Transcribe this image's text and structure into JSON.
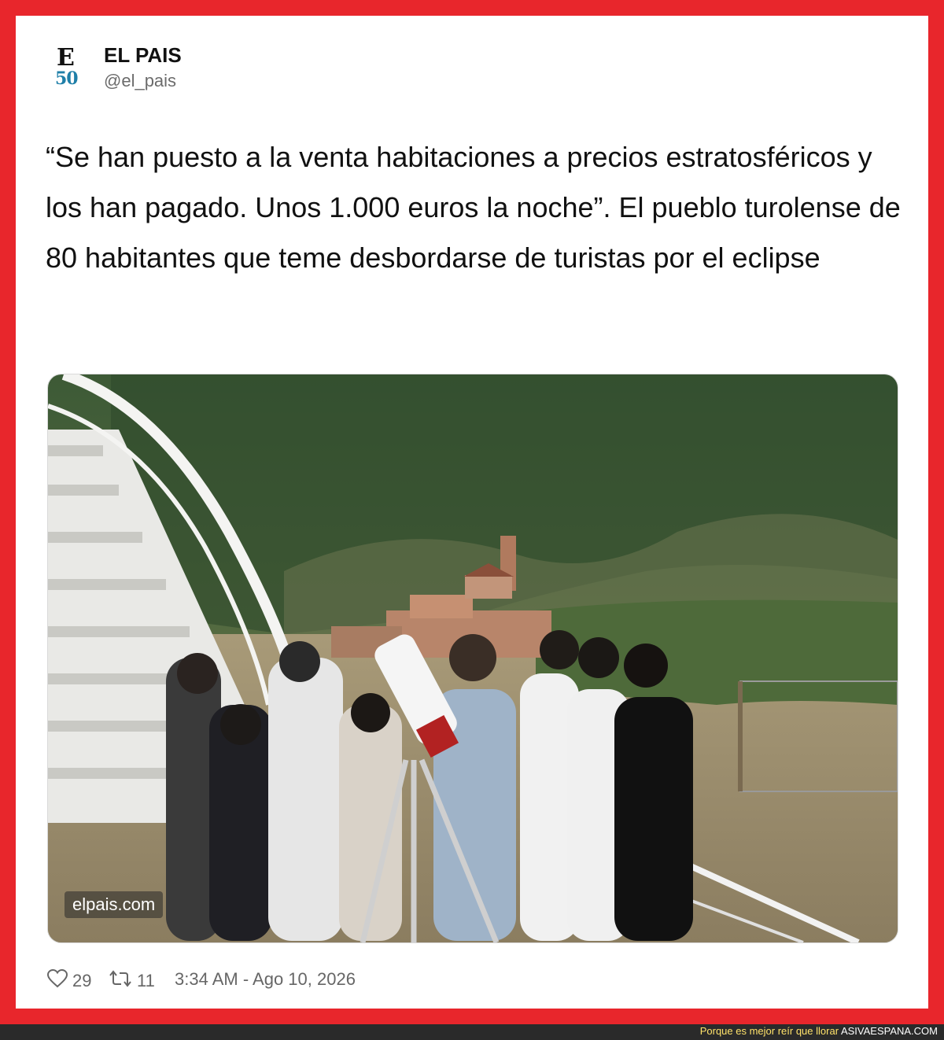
{
  "account": {
    "logo_letter": "E",
    "logo_number": "50",
    "name": "EL PAIS",
    "handle": "@el_pais"
  },
  "tweet": {
    "text": "“Se han puesto a la venta habitaciones a precios estratosféricos y los han pagado. Unos 1.000 euros la noche”. El  pueblo turolense de 80 habitantes que teme desbordarse de turistas por el eclipse",
    "image_source": "elpais.com"
  },
  "stats": {
    "likes": "29",
    "retweets": "11",
    "timestamp": "3:34 AM - Ago 10, 2026",
    "like_icon": "heart-icon",
    "retweet_icon": "retweet-icon"
  },
  "footer": {
    "tagline": "Porque es mejor reír que llorar",
    "site": "ASIVAESPANA.COM"
  },
  "colors": {
    "frame": "#e8262c",
    "footer_bg": "#2a2a2a",
    "footer_text": "#ffe26a",
    "logo_accent": "#1f7fa8"
  }
}
